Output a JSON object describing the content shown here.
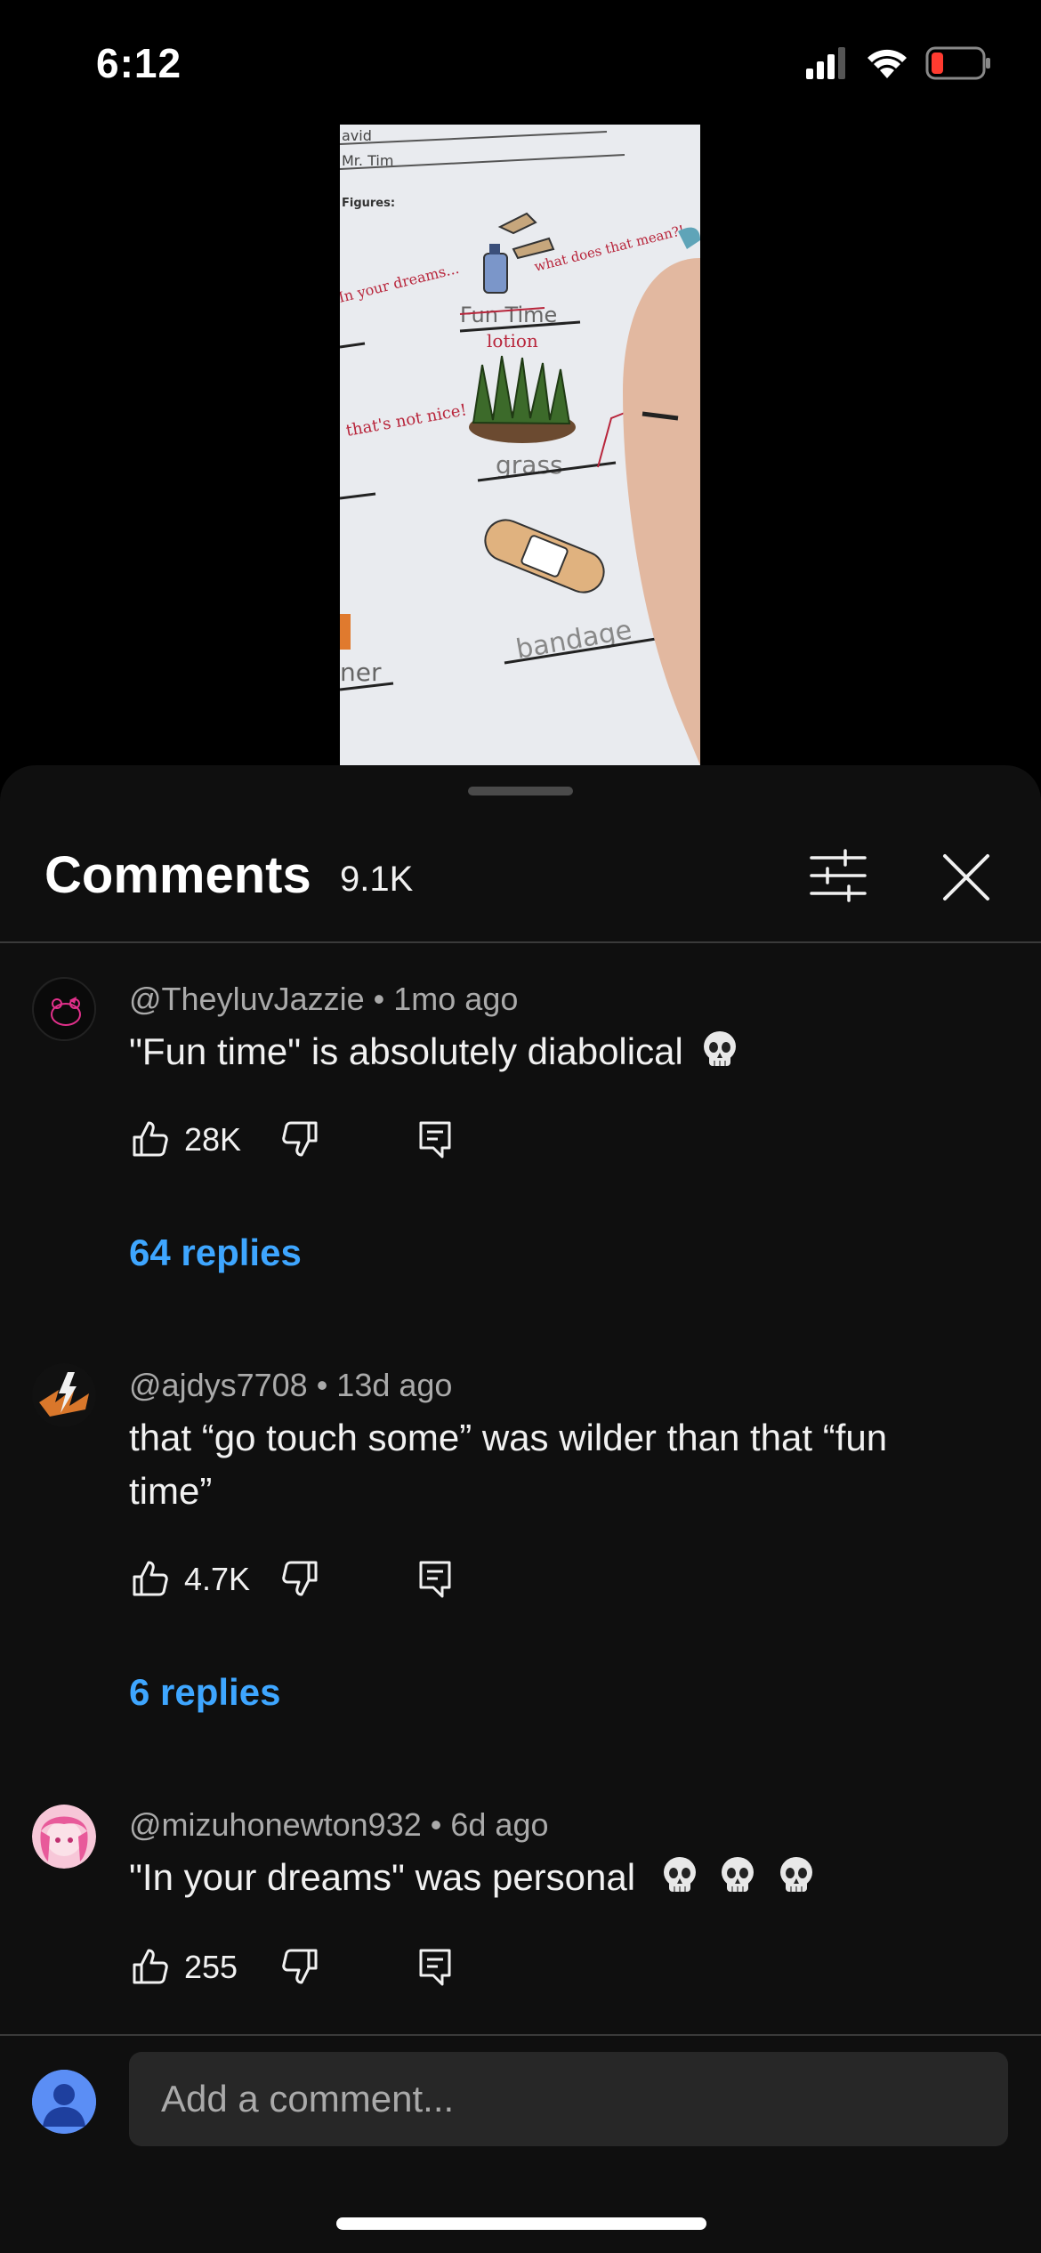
{
  "status_bar": {
    "time": "6:12",
    "icons": [
      "signal-icon",
      "wifi-icon",
      "battery-low-icon"
    ]
  },
  "video": {
    "sheet_text": {
      "name_top": "avid",
      "name_bottom": "Mr. Tim",
      "section": "Figures:",
      "note_in_your_dreams": "In your dreams...",
      "note_what": "what does that mean?!",
      "word_crossed": "Fun Time",
      "word_lotion": "lotion",
      "note_thats_not_nice": "that's not nice!",
      "word_grass": "grass",
      "word_bandage": "bandage",
      "word_partial": "ner"
    }
  },
  "comments_panel": {
    "title": "Comments",
    "count": "9.1K",
    "filter_icon": "sliders-icon",
    "close_icon": "close-icon",
    "comments": [
      {
        "author": "@TheyluvJazzie",
        "time": "1mo ago",
        "text": "\"Fun time\" is absolutely diabolical",
        "emoji": "skull",
        "likes": "28K",
        "replies": "64 replies"
      },
      {
        "author": "@ajdys7708",
        "time": "13d ago",
        "text": "that “go touch some” was wilder than that “fun time”",
        "likes": "4.7K",
        "replies": "6 replies"
      },
      {
        "author": "@mizuhonewton932",
        "time": "6d ago",
        "text": "\"In your dreams\" was personal",
        "emoji": "skull x3",
        "likes": "255"
      }
    ],
    "input_placeholder": "Add a comment..."
  },
  "colors": {
    "background": "#0f0f0f",
    "link": "#3ea6ff",
    "secondary_text": "#aaaaaa",
    "battery_low": "#ff3b30",
    "input_bg": "#272727"
  }
}
